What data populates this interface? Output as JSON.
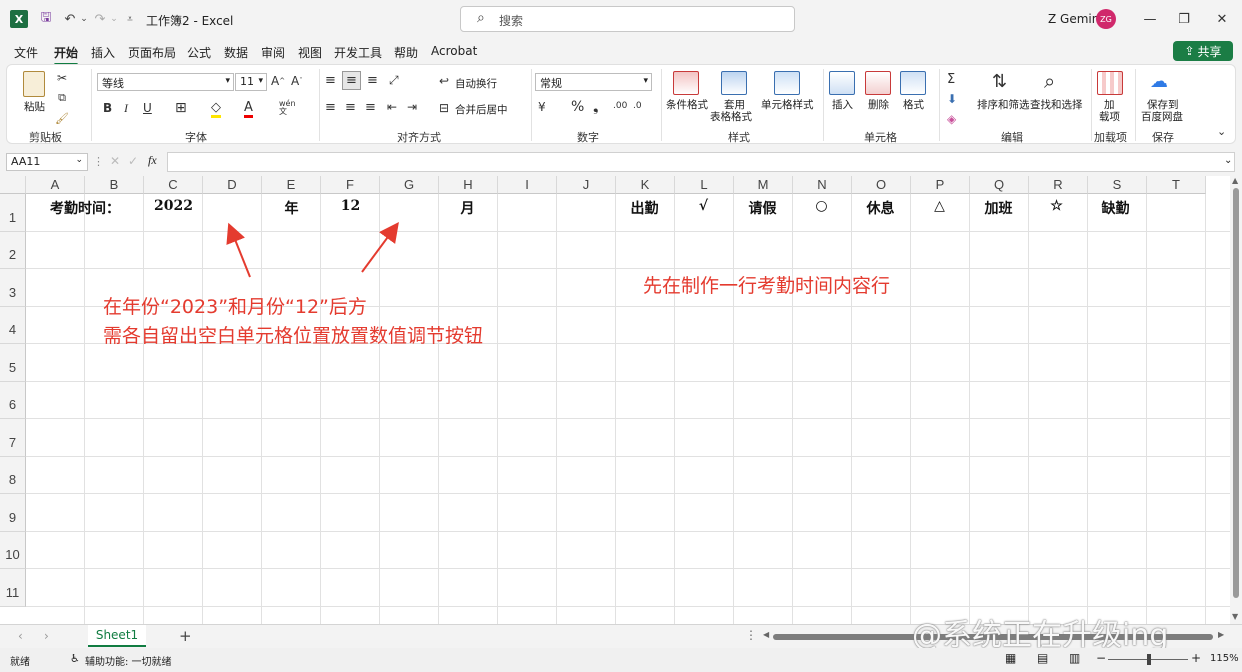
{
  "app": {
    "doc_title": "工作簿2 - Excel",
    "search_placeholder": "搜索",
    "user_name": "Z Gemini",
    "avatar_initials": "ZG",
    "share_label": "共享"
  },
  "menu": [
    "文件",
    "开始",
    "插入",
    "页面布局",
    "公式",
    "数据",
    "审阅",
    "视图",
    "开发工具",
    "帮助",
    "Acrobat"
  ],
  "ribbon": {
    "paste": "粘贴",
    "font_name": "等线",
    "font_size": "11",
    "wrap_text": "自动换行",
    "merge_center": "合并后居中",
    "number_format": "常规",
    "cond_format": "条件格式",
    "table_format_1": "套用",
    "table_format_2": "表格格式",
    "cell_styles": "单元格样式",
    "insert": "插入",
    "delete": "删除",
    "format": "格式",
    "sort_filter": "排序和筛选",
    "find_select": "查找和选择",
    "addin_1": "加",
    "addin_2": "载项",
    "save_to_1": "保存到",
    "save_to_2": "百度网盘",
    "groups": {
      "clipboard": "剪贴板",
      "font": "字体",
      "alignment": "对齐方式",
      "number": "数字",
      "styles": "样式",
      "cells": "单元格",
      "editing": "编辑",
      "addins": "加载项",
      "save": "保存"
    }
  },
  "formula_bar": {
    "name_box": "AA11",
    "fx": "fx",
    "content": ""
  },
  "sheet": {
    "columns": [
      "A",
      "B",
      "C",
      "D",
      "E",
      "F",
      "G",
      "H",
      "I",
      "J",
      "K",
      "L",
      "M",
      "N",
      "O",
      "P",
      "Q",
      "R",
      "S",
      "T"
    ],
    "rows": [
      "1",
      "2",
      "3",
      "4",
      "5",
      "6",
      "7",
      "8",
      "9",
      "10",
      "11"
    ],
    "row1": {
      "A": "考勤时间：",
      "C": "2022",
      "E": "年",
      "F": "12",
      "H": "月",
      "K": "出勤",
      "L": "√",
      "M": "请假",
      "N": "○",
      "O": "休息",
      "P": "△",
      "Q": "加班",
      "R": "☆",
      "S": "缺勤"
    }
  },
  "annotations": {
    "left_line1": "在年份“2023”和月份“12”后方",
    "left_line2": "需各自留出空白单元格位置放置数值调节按钮",
    "right": "先在制作一行考勤时间内容行"
  },
  "tabs": {
    "sheet_name": "Sheet1",
    "add": "+"
  },
  "status": {
    "ready": "就绪",
    "accessibility": "辅助功能: 一切就绪",
    "zoom": "115%"
  },
  "watermark": "@系统正在升级ing",
  "colors": {
    "excel_green": "#107c41",
    "annotation_red": "#e43b2f",
    "avatar": "#d0286b"
  }
}
